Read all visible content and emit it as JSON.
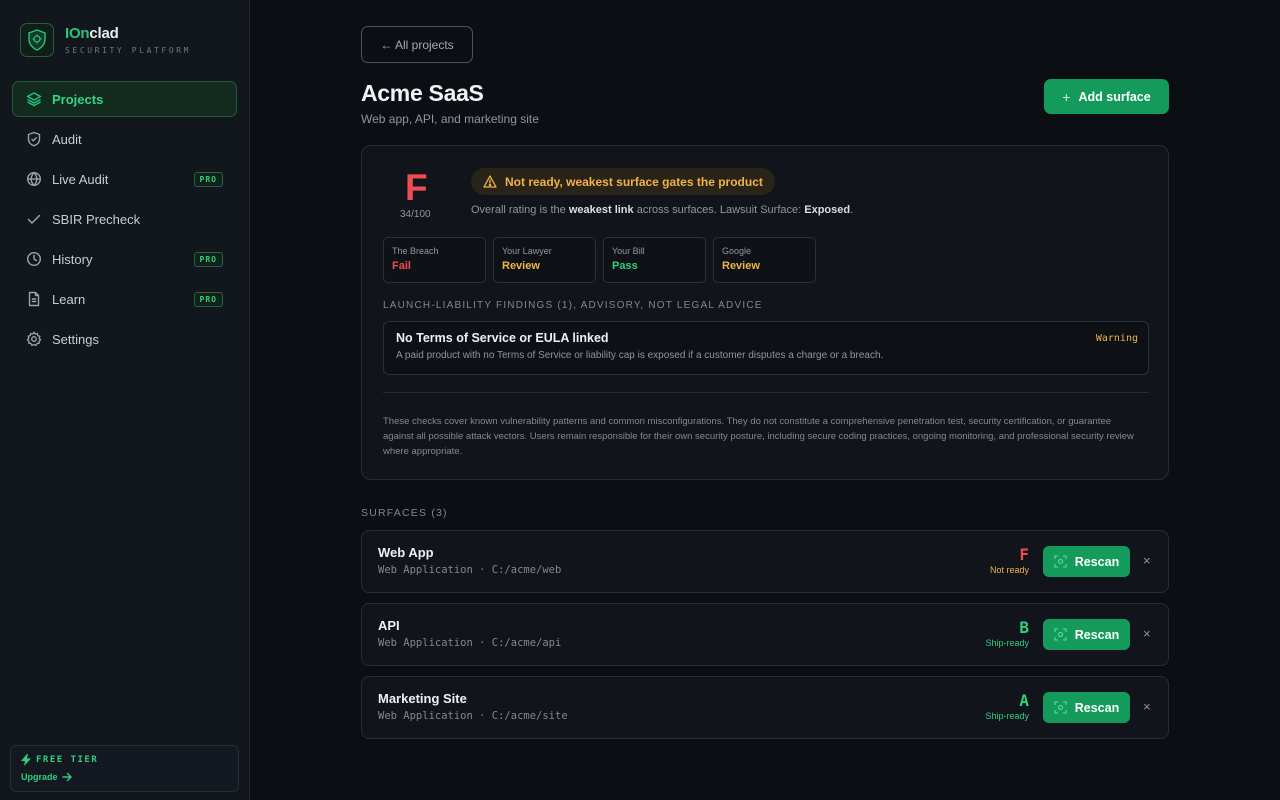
{
  "brand": {
    "name_part1": "IOn",
    "name_part2": "clad",
    "subtitle": "SECURITY PLATFORM"
  },
  "colors": {
    "accent": "#149b5c",
    "fail": "#ef4d55",
    "warning": "#f0b24a",
    "pass": "#2fce80"
  },
  "sidebar": {
    "items": [
      {
        "label": "Projects",
        "icon": "layers-icon",
        "active": true,
        "pro": ""
      },
      {
        "label": "Audit",
        "icon": "shield-check-icon",
        "pro": ""
      },
      {
        "label": "Live Audit",
        "icon": "globe-icon",
        "pro": "PRO"
      },
      {
        "label": "SBIR Precheck",
        "icon": "check-icon",
        "pro": ""
      },
      {
        "label": "History",
        "icon": "clock-icon",
        "pro": "PRO"
      },
      {
        "label": "Learn",
        "icon": "document-icon",
        "pro": "PRO"
      },
      {
        "label": "Settings",
        "icon": "gear-icon",
        "pro": ""
      }
    ],
    "tier": {
      "label": "FREE TIER",
      "upgrade": "Upgrade"
    }
  },
  "header": {
    "back": "← All projects",
    "title": "Acme SaaS",
    "subtitle": "Web app, API, and marketing site",
    "add_button": "Add surface",
    "add_icon": "+"
  },
  "summary": {
    "grade": "F",
    "score": "34/100",
    "status": "Not ready, weakest surface gates the product",
    "overall_pre": "Overall rating is the ",
    "overall_bold1": "weakest link",
    "overall_mid": " across surfaces. Lawsuit Surface: ",
    "overall_bold2": "Exposed",
    "overall_end": ".",
    "checks": [
      {
        "name": "The Breach",
        "value": "Fail",
        "color": "#ef4d55"
      },
      {
        "name": "Your Lawyer",
        "value": "Review",
        "color": "#f0b24a"
      },
      {
        "name": "Your Bill",
        "value": "Pass",
        "color": "#2fce80"
      },
      {
        "name": "Google",
        "value": "Review",
        "color": "#f0b24a"
      }
    ],
    "findings_heading": "LAUNCH-LIABILITY FINDINGS (1), ADVISORY, NOT LEGAL ADVICE",
    "finding": {
      "title": "No Terms of Service or EULA linked",
      "description": "A paid product with no Terms of Service or liability cap is exposed if a customer disputes a charge or a breach.",
      "severity": "Warning"
    },
    "disclaimer": "These checks cover known vulnerability patterns and common misconfigurations. They do not constitute a comprehensive penetration test, security certification, or guarantee against all possible attack vectors. Users remain responsible for their own security posture, including secure coding practices, ongoing monitoring, and professional security review where appropriate."
  },
  "surfaces": {
    "heading": "SURFACES (3)",
    "rescan_label": "Rescan",
    "close_label": "×",
    "items": [
      {
        "name": "Web App",
        "meta": "Web Application · C:/acme/web",
        "grade": "F",
        "status": "Not ready",
        "grade_color": "#ef4d55",
        "status_color": "#f0b24a"
      },
      {
        "name": "API",
        "meta": "Web Application · C:/acme/api",
        "grade": "B",
        "status": "Ship-ready",
        "grade_color": "#2fce80",
        "status_color": "#2fce80"
      },
      {
        "name": "Marketing Site",
        "meta": "Web Application · C:/acme/site",
        "grade": "A",
        "status": "Ship-ready",
        "grade_color": "#2fce80",
        "status_color": "#2fce80"
      }
    ]
  }
}
